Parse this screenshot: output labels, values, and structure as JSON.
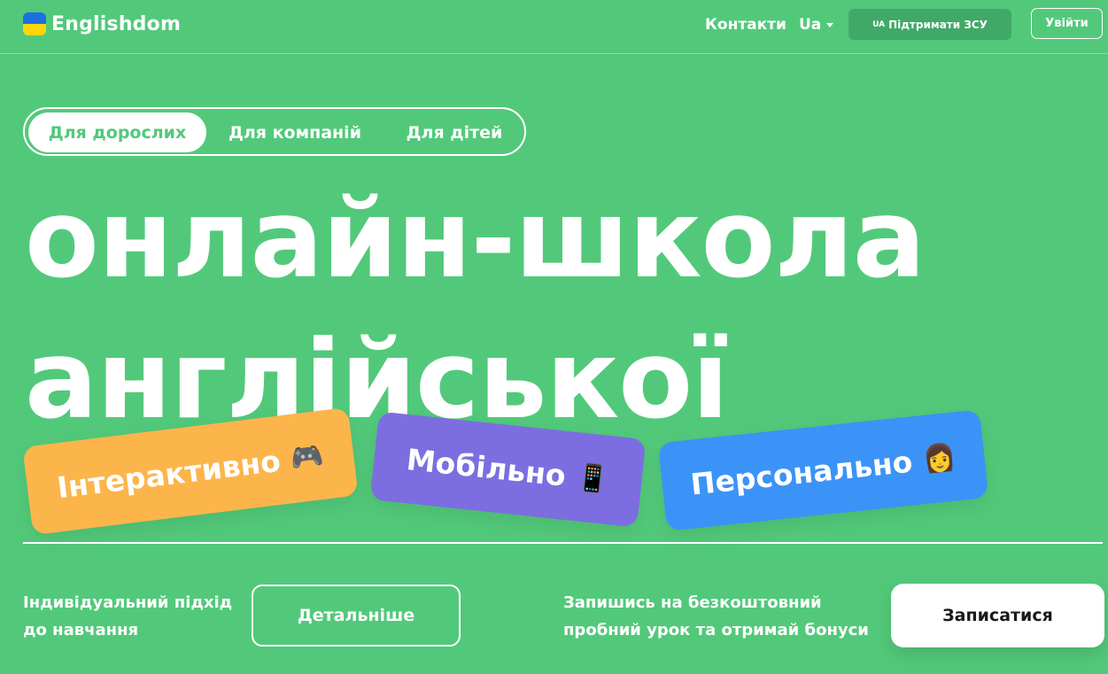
{
  "header": {
    "logo_text": "Englishdom",
    "contacts": "Контакти",
    "lang": "Ua",
    "support_prefix": "UA",
    "support": "Підтримати ЗСУ",
    "login": "Увійти"
  },
  "tabs": [
    {
      "label": "Для дорослих",
      "active": true
    },
    {
      "label": "Для компаній",
      "active": false
    },
    {
      "label": "Для дітей",
      "active": false
    }
  ],
  "hero": {
    "line1": "онлайн-школа",
    "line2": "англійської"
  },
  "cards": [
    {
      "label": "Інтерактивно",
      "emoji": "🎮",
      "color": "#fcb54b"
    },
    {
      "label": "Мобільно",
      "emoji": "📱",
      "color": "#7c6ee0"
    },
    {
      "label": "Персонально",
      "emoji": "👩",
      "color": "#3b93f7"
    }
  ],
  "bottom": {
    "left_text": "Індивідуальний підхід до навчання",
    "details": "Детальніше",
    "right_text": "Запишись на безкоштовний пробний урок та отримай бонуси",
    "signup": "Записатися"
  },
  "colors": {
    "background": "#52c97a",
    "accent": "#40a968"
  }
}
